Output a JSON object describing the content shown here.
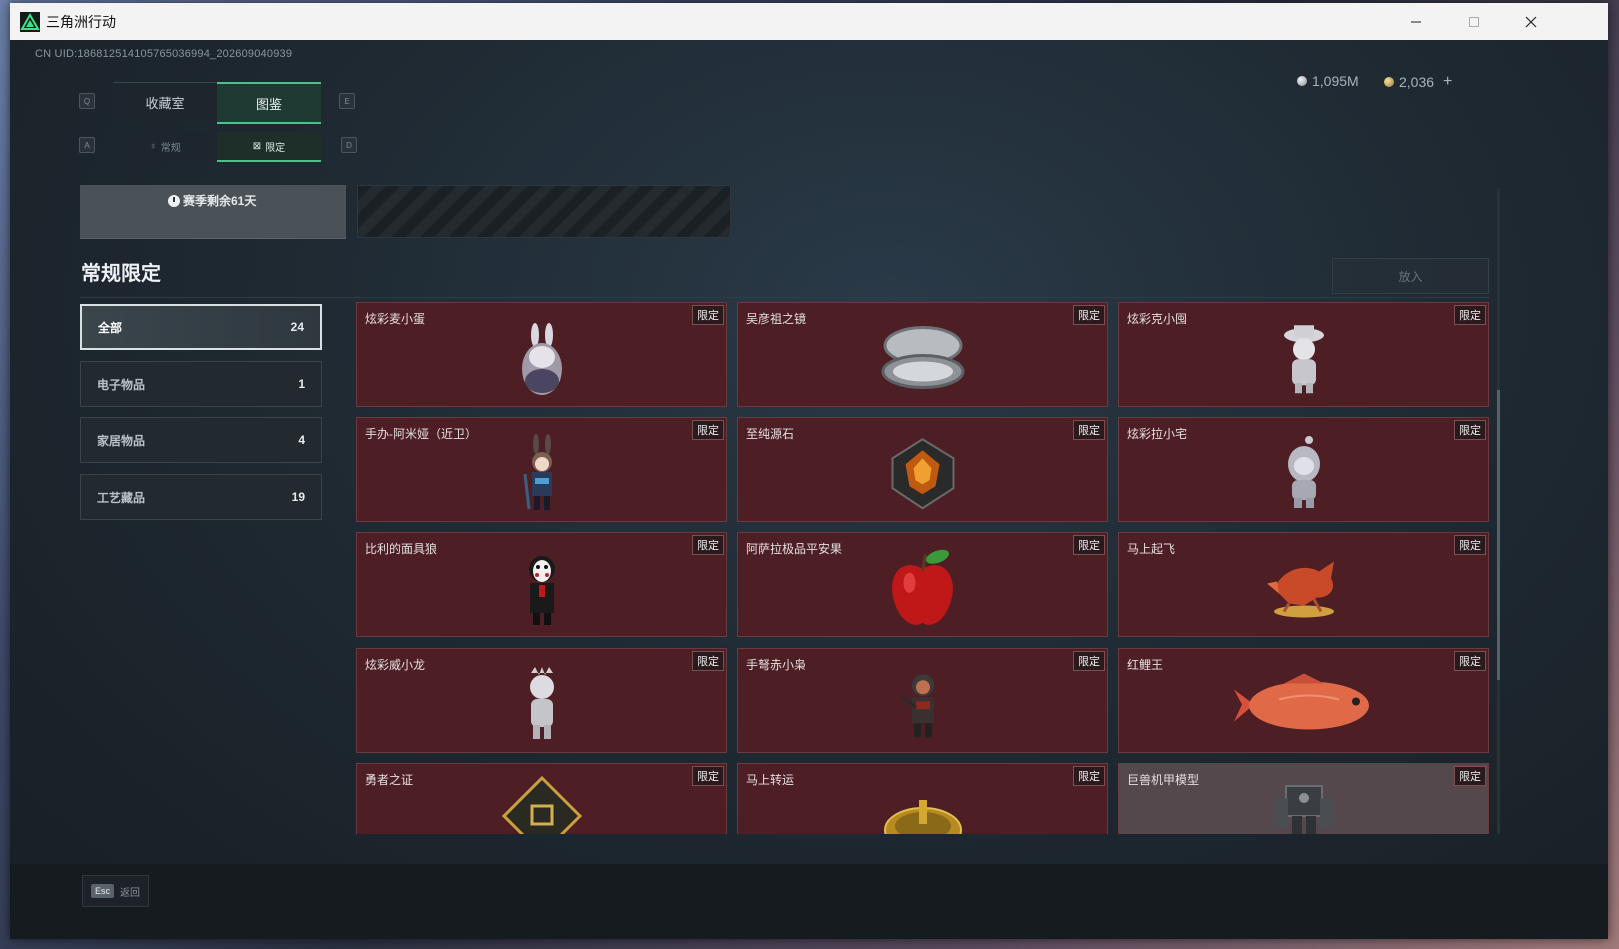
{
  "window": {
    "title": "三角洲行动"
  },
  "uid": "CN UID:18681251410576503699​4_202609040939",
  "currency": {
    "silver": "1,095M",
    "gold": "2,036",
    "add": "+"
  },
  "keys": {
    "q": "Q",
    "e": "E",
    "a": "A",
    "d": "D"
  },
  "tabs": {
    "main": [
      {
        "label": "收藏室"
      },
      {
        "label": "图鉴"
      }
    ],
    "sub": [
      {
        "label": "常规"
      },
      {
        "label": "限定"
      }
    ]
  },
  "banner": {
    "season": "赛季剩余61天"
  },
  "section": {
    "title": "常规限定",
    "put_button": "放入"
  },
  "categories": [
    {
      "label": "全部",
      "count": "24"
    },
    {
      "label": "电子物品",
      "count": "1"
    },
    {
      "label": "家居物品",
      "count": "4"
    },
    {
      "label": "工艺藏品",
      "count": "19"
    }
  ],
  "limit_tag": "限定",
  "items": [
    {
      "name": "炫彩麦小蛋",
      "icon": "bunny-egg-figure"
    },
    {
      "name": "吴彦祖之镜",
      "icon": "compact-mirror"
    },
    {
      "name": "炫彩克小囤",
      "icon": "silver-hat-figure"
    },
    {
      "name": "手办-阿米娅（近卫）",
      "icon": "amiya-figure"
    },
    {
      "name": "至纯源石",
      "icon": "originium-crystal"
    },
    {
      "name": "炫彩拉小宅",
      "icon": "hooded-figure"
    },
    {
      "name": "比利的面具狼",
      "icon": "jigsaw-puppet"
    },
    {
      "name": "阿萨拉极品平安果",
      "icon": "red-apple"
    },
    {
      "name": "马上起飞",
      "icon": "flying-horse"
    },
    {
      "name": "炫彩威小龙",
      "icon": "silver-dragon-figure"
    },
    {
      "name": "手弩赤小枭",
      "icon": "crossbow-figure"
    },
    {
      "name": "红鲤王",
      "icon": "red-carp"
    },
    {
      "name": "勇者之证",
      "icon": "gold-card"
    },
    {
      "name": "马上转运",
      "icon": "gold-roulette"
    },
    {
      "name": "巨兽机甲模型",
      "icon": "mech-model"
    }
  ],
  "footer": {
    "esc_key": "Esc",
    "esc_label": "返回"
  },
  "colors": {
    "accent": "#4cc08a",
    "card_bg": "#4e1e25",
    "card_gray": "#54484c"
  }
}
